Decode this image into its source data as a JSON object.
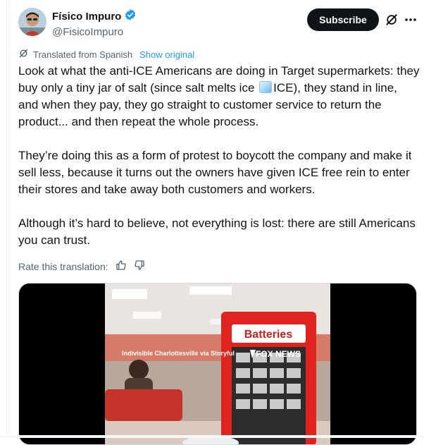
{
  "author": {
    "display_name": "Físico Impuro",
    "handle": "@FisicoImpuro",
    "verified": true
  },
  "header": {
    "subscribe_label": "Subscribe"
  },
  "translation": {
    "translated_from": "Translated from Spanish",
    "show_original": "Show original",
    "rate_label": "Rate this translation:"
  },
  "tweet": {
    "p1_before_emoji": "Look at what the anti-ICE Americans are doing in Target supermarkets: they buy only a tiny jar of salt (since salt melts ice ",
    "p1_after_emoji": "ICE), they stand in line, and when they pay, they go straight to customer service to return the product... and then repeat the whole process.",
    "p2": "They’re doing this as a form of protest to boycott the company and make it sell less, because it turns out the owners have given ICE free rein to enter their stores and take away both customers and workers.",
    "p3": "Although it’s hard to believe, not everything is lost: there are still Americans you can trust."
  },
  "video": {
    "credit": "Indivisible Charlottesville via Storyful",
    "network": "FOX NEWS",
    "sign_text": "Batteries"
  },
  "colors": {
    "accent": "#1d9bf0",
    "text": "#0f1419",
    "muted": "#536471",
    "button_bg": "#0f1419"
  },
  "icons": [
    "verified-badge-icon",
    "grok-icon",
    "more-icon",
    "translate-icon",
    "thumbs-up-icon",
    "thumbs-down-icon",
    "ice-cube-emoji"
  ]
}
